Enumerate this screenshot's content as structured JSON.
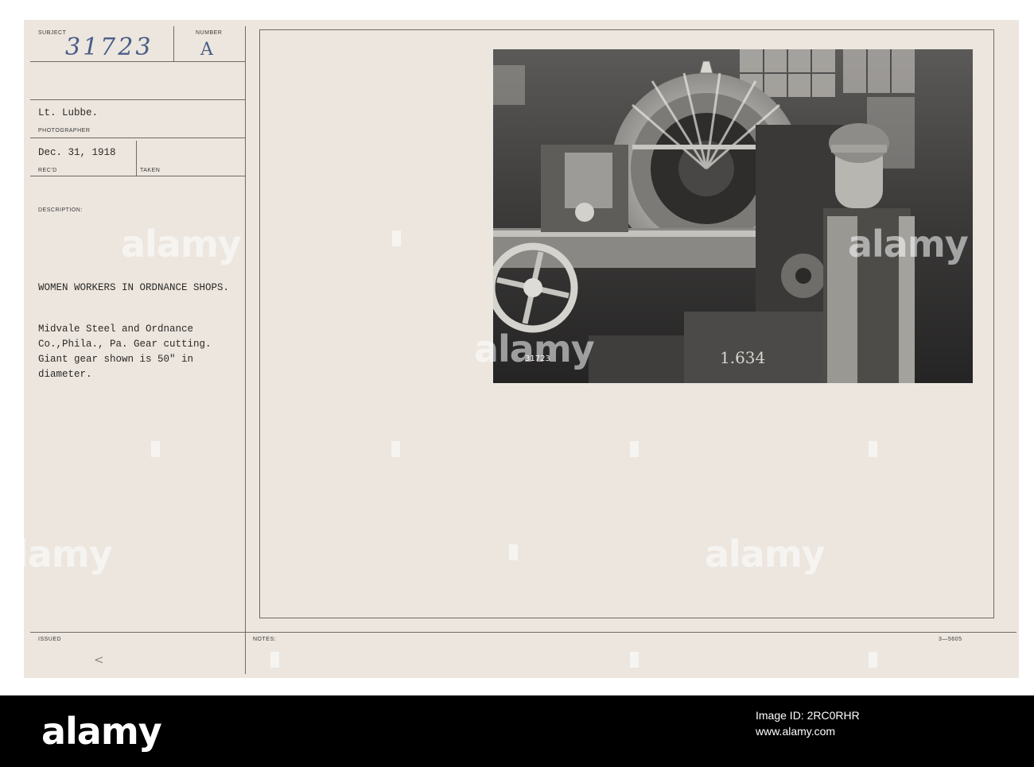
{
  "card": {
    "labels": {
      "subject": "SUBJECT",
      "number": "NUMBER",
      "photographer": "PHOTOGRAPHER",
      "recd": "REC'D",
      "taken": "TAKEN",
      "description": "DESCRIPTION:",
      "issued": "ISSUED",
      "notes": "NOTES:",
      "form_number": "3—5605"
    },
    "subject_value": "31723",
    "number_value": "A",
    "photographer_value": "Lt. Lubbe.",
    "date_value": "Dec. 31, 1918",
    "headline": "WOMEN WORKERS IN ORDNANCE SHOPS.",
    "description_lines": [
      "Midvale Steel and Ordnance",
      "Co.,Phila., Pa. Gear cutting.",
      "Giant gear shown is 50\" in",
      "diameter."
    ],
    "issued_mark": "<"
  },
  "photo": {
    "negative_number": "31723",
    "machine_marking": "1.634"
  },
  "watermark": {
    "text": "alamy"
  },
  "footer": {
    "logo": "alamy",
    "image_id_label": "Image ID:",
    "image_id": "2RC0RHR",
    "site": "www.alamy.com"
  }
}
